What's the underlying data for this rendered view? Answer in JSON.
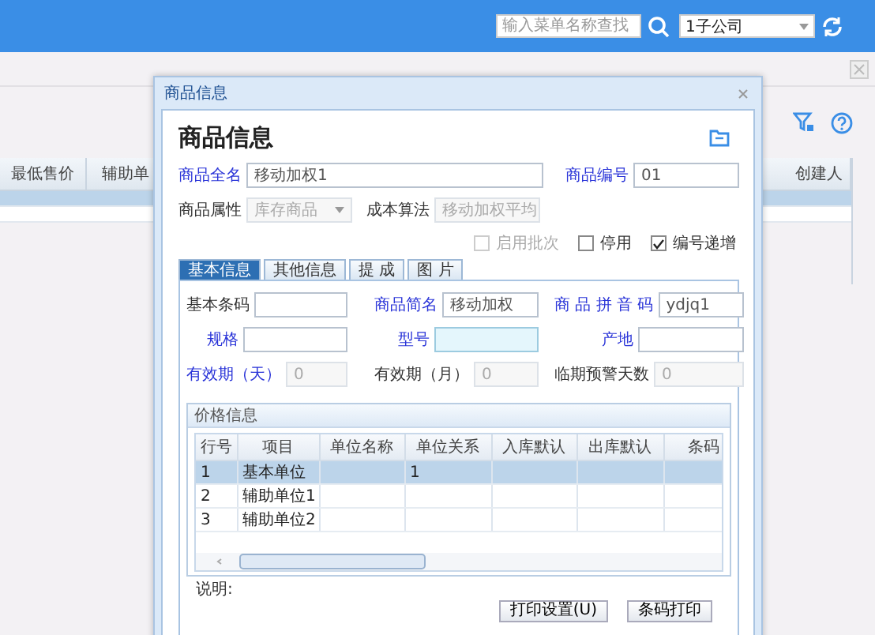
{
  "topbar": {
    "search": {
      "placeholder": "输入菜单名称查找"
    },
    "company": {
      "value": "1子公司"
    }
  },
  "background_table": {
    "columns": [
      "最低售价",
      "辅助单",
      "创建人"
    ],
    "rows": [
      {
        "selected": true
      },
      {
        "selected": false
      }
    ]
  },
  "dialog": {
    "title": "商品信息",
    "heading": "商品信息",
    "top_rows": [
      [
        {
          "label": "商品全名",
          "value": "移动加权1",
          "kind": "text-wide",
          "required": true,
          "disabled": false
        },
        {
          "label": "商品编号",
          "value": "01",
          "kind": "text",
          "required": true,
          "disabled": false
        }
      ],
      [
        {
          "label": "商品属性",
          "value": "库存商品",
          "kind": "select",
          "required": false,
          "disabled": true
        },
        {
          "label": "成本算法",
          "value": "移动加权平均",
          "kind": "select",
          "required": false,
          "disabled": true
        }
      ]
    ],
    "options": [
      {
        "label": "启用批次",
        "checked": false,
        "disabled": true
      },
      {
        "label": "停用",
        "checked": false,
        "disabled": false
      },
      {
        "label": "编号递增",
        "checked": true,
        "disabled": false
      }
    ],
    "tabs": [
      {
        "label": "基本信息",
        "selected": true
      },
      {
        "label": "其他信息",
        "selected": false
      },
      {
        "label": "提 成",
        "selected": false
      },
      {
        "label": "图 片",
        "selected": false
      }
    ],
    "field_rows": [
      [
        {
          "label": "基本条码",
          "required": false,
          "disabled": false,
          "focused": false
        },
        {
          "label": "商品简名",
          "value": "移动加权",
          "required": true,
          "disabled": false,
          "focused": false
        },
        {
          "label": "商 品 拼 音 码",
          "value": "ydjq1",
          "required": true,
          "disabled": false,
          "focused": false
        }
      ],
      [
        {
          "label": "规格",
          "required": true,
          "disabled": false,
          "focused": false
        },
        {
          "label": "型号",
          "required": true,
          "disabled": false,
          "focused": true
        },
        {
          "label": "产地",
          "required": true,
          "disabled": false,
          "focused": false
        }
      ],
      [
        {
          "label": "有效期（天）",
          "value": "0",
          "required": true,
          "disabled": true,
          "focused": false
        },
        {
          "label": "有效期（月）",
          "value": "0",
          "required": false,
          "disabled": true,
          "focused": false
        },
        {
          "label": "临期预警天数",
          "value": "0",
          "required": false,
          "disabled": true,
          "focused": false
        }
      ]
    ],
    "price_panel": {
      "title": "价格信息",
      "columns": [
        "行号",
        "项目",
        "单位名称",
        "单位关系",
        "入库默认",
        "出库默认",
        "条码"
      ],
      "rows": [
        {
          "cells": [
            "1",
            "基本单位",
            "",
            "1",
            "",
            "",
            ""
          ],
          "selected": true
        },
        {
          "cells": [
            "2",
            "辅助单位1",
            "",
            "",
            "",
            "",
            ""
          ],
          "selected": false
        },
        {
          "cells": [
            "3",
            "辅助单位2",
            "",
            "",
            "",
            "",
            ""
          ],
          "selected": false
        }
      ]
    },
    "note_label": "说明:",
    "buttons": [
      "打印设置(U)",
      "条码打印"
    ]
  }
}
